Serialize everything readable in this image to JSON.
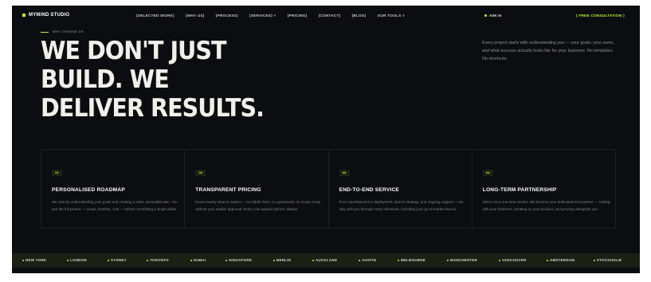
{
  "brand": {
    "name": "MYMIND STUDIO"
  },
  "nav": {
    "links": [
      {
        "label": "(SELECTED WORK)"
      },
      {
        "label": "(WHY US)"
      },
      {
        "label": "(PROCESS)"
      },
      {
        "label": "(SERVICES) ˅"
      },
      {
        "label": "(PRICING)"
      },
      {
        "label": "(CONTACT)"
      },
      {
        "label": "(BLOG)"
      },
      {
        "label": "OUR TOOLS ˅"
      }
    ],
    "ask_label": "ASK AI",
    "cta_label": "( FREE CONSULTATION )"
  },
  "hero": {
    "eyebrow": "WHY CHOOSE US",
    "headline_lines": [
      "WE DON'T JUST",
      "BUILD. WE",
      "DELIVER RESULTS."
    ],
    "intro": "Every project starts with understanding you — your goals, your users, and what success actually looks like for your business. No templates. No shortcuts."
  },
  "cards": [
    {
      "num": "01",
      "title": "PERSONALISED ROADMAP",
      "desc": "We start by understanding your goals and creating a clear, actionable plan. You see the full picture — scope, timeline, cost — before committing a single dollar."
    },
    {
      "num": "02",
      "title": "TRANSPARENT PRICING",
      "desc": "Know exactly what to expect — no hidden fees, no guesswork, no scope creep without your explicit approval. Every cost agreed upfront, always."
    },
    {
      "num": "03",
      "title": "END-TO-END SERVICE",
      "desc": "From development to deployment, launch strategy, and ongoing support — we stay with you through every milestone, including your go-to-market launch."
    },
    {
      "num": "04",
      "title": "LONG-TERM PARTNERSHIP",
      "desc": "We're not a one-time vendor. We become your dedicated tech partner — scaling with your business, iterating on your product, and growing alongside you."
    }
  ],
  "cities": [
    "NEW YORK",
    "LONDON",
    "SYDNEY",
    "TORONTO",
    "DUBAI",
    "SINGAPORE",
    "BERLIN",
    "AUCKLAND",
    "AUSTIN",
    "MELBOURNE",
    "MANCHESTER",
    "VANCOUVER",
    "AMSTERDAM",
    "STOCKHOLM"
  ],
  "colors": {
    "accent": "#b8ff3c",
    "background": "#0c0d11",
    "strip": "#1b1f14"
  }
}
